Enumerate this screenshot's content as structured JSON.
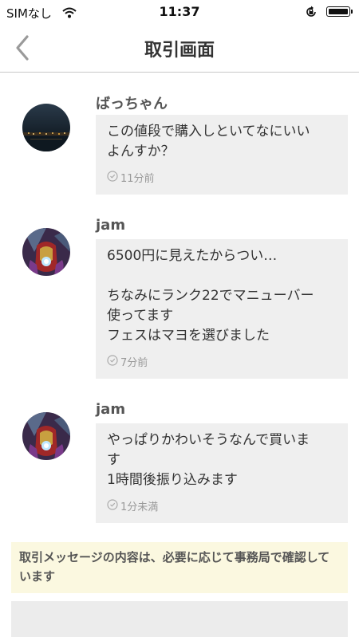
{
  "status_bar": {
    "carrier": "SIMなし",
    "time": "11:37"
  },
  "nav": {
    "title": "取引画面",
    "back_icon": "chevron-left-icon"
  },
  "messages": [
    {
      "sender": "ばっちゃん",
      "text": "この値段で購入しといてなにいい\nよんすか？",
      "time": "11分前"
    },
    {
      "sender": "jam",
      "text": "6500円に見えたからつい…\n\nちなみにランク22でマニューバー\n使ってます\nフェスはマヨを選びました",
      "time": "7分前"
    },
    {
      "sender": "jam",
      "text": "やっぱりかわいそうなんで買いま\nす\n1時間後振り込みます",
      "time": "1分未満"
    }
  ],
  "notice": {
    "text": "取引メッセージの内容は、必要に応じて事務局で確認しています"
  },
  "colors": {
    "bubble_bg": "#efefef",
    "notice_bg": "#fbf8e0",
    "divider": "#c8c8c8"
  }
}
